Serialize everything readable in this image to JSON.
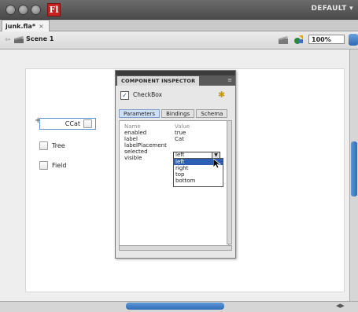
{
  "window": {
    "workspace": "DEFAULT ▾",
    "logo_letter": "Fl"
  },
  "document": {
    "tab_label": "junk.fla*",
    "tab_close": "×"
  },
  "edit_bar": {
    "back_arrow": "⇦",
    "scene_label": "Scene 1",
    "zoom": "100%"
  },
  "stage": {
    "selected_checkbox_label": "CCat",
    "checkboxes": [
      {
        "label": "Tree"
      },
      {
        "label": "Field"
      }
    ],
    "registration_mark": "+"
  },
  "inspector": {
    "title": "COMPONENT INSPECTOR",
    "menu_icon": "≡",
    "component_checked": "✓",
    "component_name": "CheckBox",
    "tabs": [
      {
        "label": "Parameters",
        "active": true
      },
      {
        "label": "Bindings",
        "active": false
      },
      {
        "label": "Schema",
        "active": false
      }
    ],
    "columns": {
      "name": "Name",
      "value": "Value"
    },
    "params": [
      {
        "name": "enabled",
        "value": "true"
      },
      {
        "name": "label",
        "value": "Cat"
      },
      {
        "name": "labelPlacement",
        "value": ""
      },
      {
        "name": "selected",
        "value": ""
      },
      {
        "name": "visible",
        "value": ""
      }
    ],
    "dropdown": {
      "selected": "left",
      "arrow": "▼",
      "options": [
        "left",
        "right",
        "top",
        "bottom"
      ],
      "highlighted": "left"
    }
  },
  "colors": {
    "accent_blue": "#2f6cb8",
    "highlight": "#2c5fb3",
    "logo_red": "#c6211f"
  }
}
